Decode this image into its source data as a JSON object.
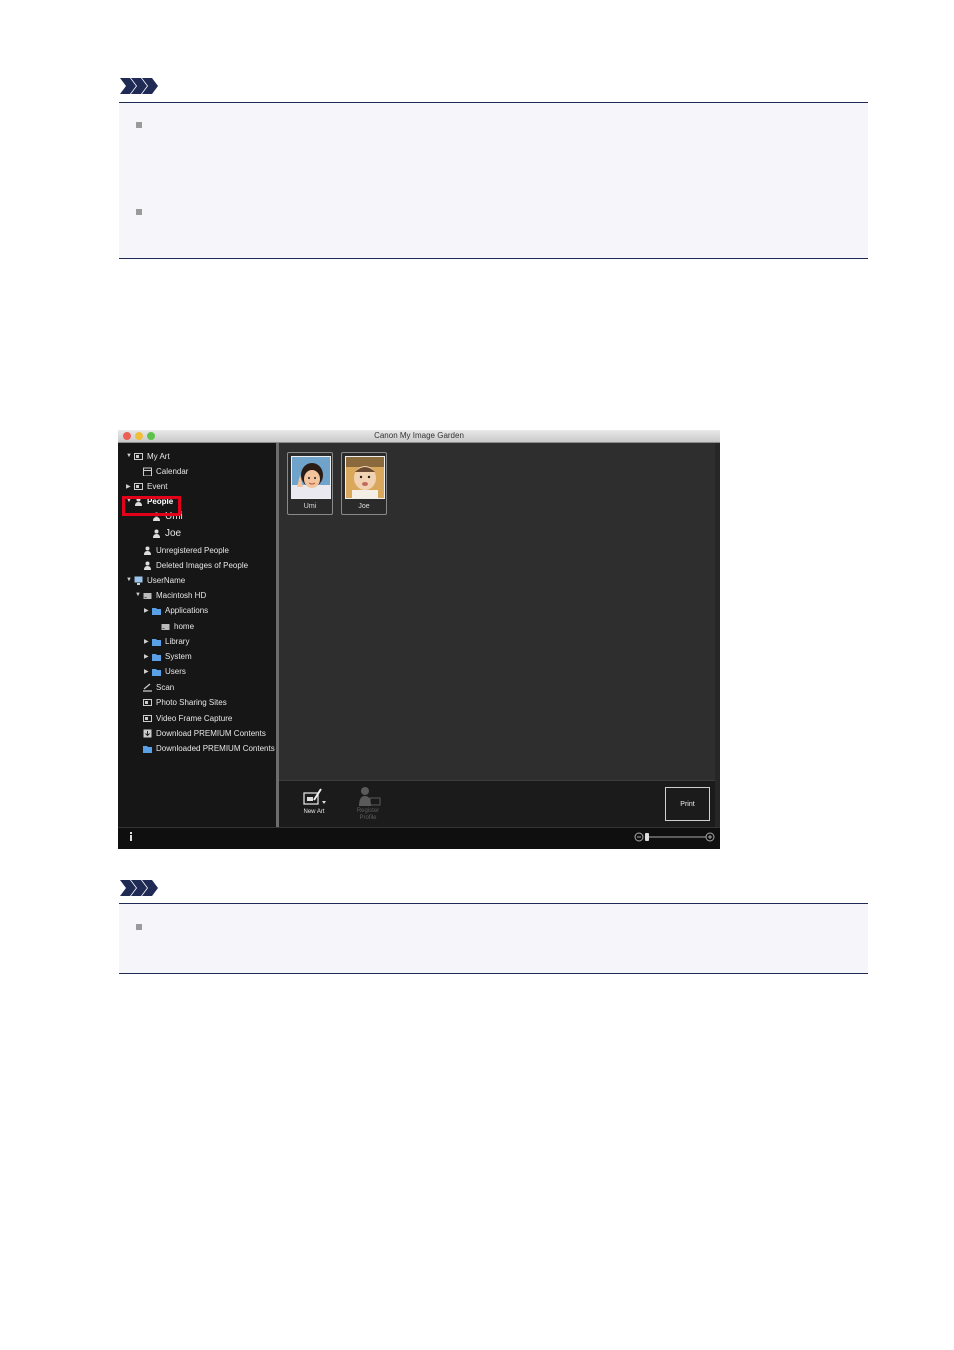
{
  "window": {
    "title": "Canon My Image Garden",
    "colors": {
      "close": "#ec5f56",
      "minimize": "#f2bd3b",
      "zoom": "#5fc24a",
      "highlight": "#e3001b"
    }
  },
  "sidebar": {
    "items": [
      {
        "label": "My Art",
        "expand": "▼",
        "icon": "my-art-icon"
      },
      {
        "label": "Calendar",
        "expand": "",
        "icon": "calendar-icon"
      },
      {
        "label": "Event",
        "expand": "▶",
        "icon": "event-icon"
      },
      {
        "label": "People",
        "expand": "▼",
        "icon": "people-icon"
      },
      {
        "label": "Umi",
        "expand": "",
        "icon": "person-icon"
      },
      {
        "label": "Joe",
        "expand": "",
        "icon": "person-icon"
      },
      {
        "label": "Unregistered People",
        "expand": "",
        "icon": "unregistered-people-icon"
      },
      {
        "label": "Deleted Images of People",
        "expand": "",
        "icon": "deleted-people-icon"
      },
      {
        "label": "UserName",
        "expand": "▼",
        "icon": "computer-icon"
      },
      {
        "label": "Macintosh HD",
        "expand": "▼",
        "icon": "hard-drive-icon"
      },
      {
        "label": "Applications",
        "expand": "▶",
        "icon": "folder-icon"
      },
      {
        "label": "home",
        "expand": "",
        "icon": "drive-icon"
      },
      {
        "label": "Library",
        "expand": "▶",
        "icon": "folder-icon"
      },
      {
        "label": "System",
        "expand": "▶",
        "icon": "folder-icon"
      },
      {
        "label": "Users",
        "expand": "▶",
        "icon": "folder-icon"
      },
      {
        "label": "Scan",
        "expand": "",
        "icon": "scan-icon"
      },
      {
        "label": "Photo Sharing Sites",
        "expand": "",
        "icon": "photo-sharing-icon"
      },
      {
        "label": "Video Frame Capture",
        "expand": "",
        "icon": "video-capture-icon"
      },
      {
        "label": "Download PREMIUM Contents",
        "expand": "",
        "icon": "download-icon"
      },
      {
        "label": "Downloaded PREMIUM Contents",
        "expand": "",
        "icon": "folder-icon"
      }
    ]
  },
  "thumbnails": [
    {
      "label": "Umi"
    },
    {
      "label": "Joe"
    }
  ],
  "toolbar": {
    "new_art_label": "New Art",
    "register_profile_label": "Register\nProfile",
    "print_label": "Print"
  }
}
